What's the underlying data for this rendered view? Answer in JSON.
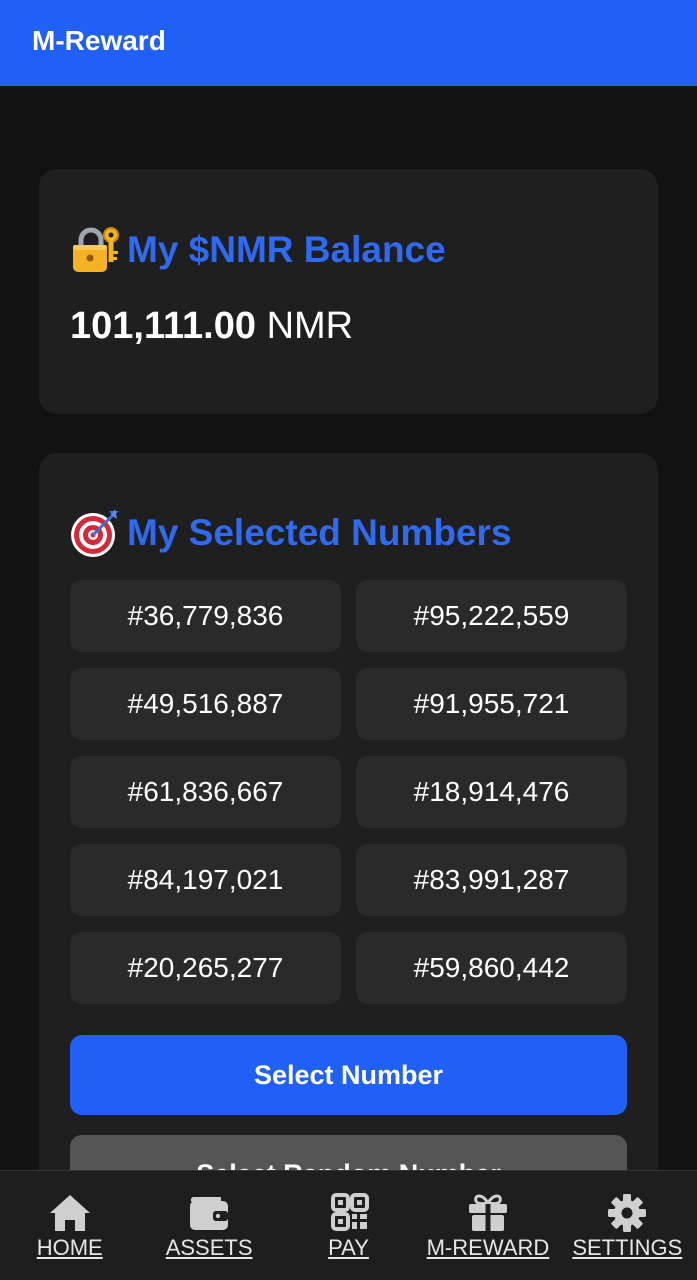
{
  "app": {
    "title": "M-Reward"
  },
  "balance": {
    "icon": "lock-with-key-icon",
    "heading": "My $NMR Balance",
    "amount": "101,111.00",
    "unit": "NMR"
  },
  "numbers": {
    "icon": "target-icon",
    "heading": "My Selected Numbers",
    "items": [
      "#36,779,836",
      "#95,222,559",
      "#49,516,887",
      "#91,955,721",
      "#61,836,667",
      "#18,914,476",
      "#84,197,021",
      "#83,991,287",
      "#20,265,277",
      "#59,860,442"
    ],
    "select_label": "Select Number",
    "random_label": "Select Random Number"
  },
  "nav": {
    "items": [
      {
        "label": "HOME",
        "icon": "home-icon"
      },
      {
        "label": "ASSETS",
        "icon": "wallet-icon"
      },
      {
        "label": "PAY",
        "icon": "qr-code-icon"
      },
      {
        "label": "M-REWARD",
        "icon": "gift-icon"
      },
      {
        "label": "SETTINGS",
        "icon": "gear-icon"
      }
    ]
  },
  "colors": {
    "accent": "#2160f5",
    "heading": "#2f6bf2",
    "background": "#121212",
    "card": "#1f1f1f",
    "chip": "#2a2a2a",
    "secondary_button": "#555555"
  }
}
